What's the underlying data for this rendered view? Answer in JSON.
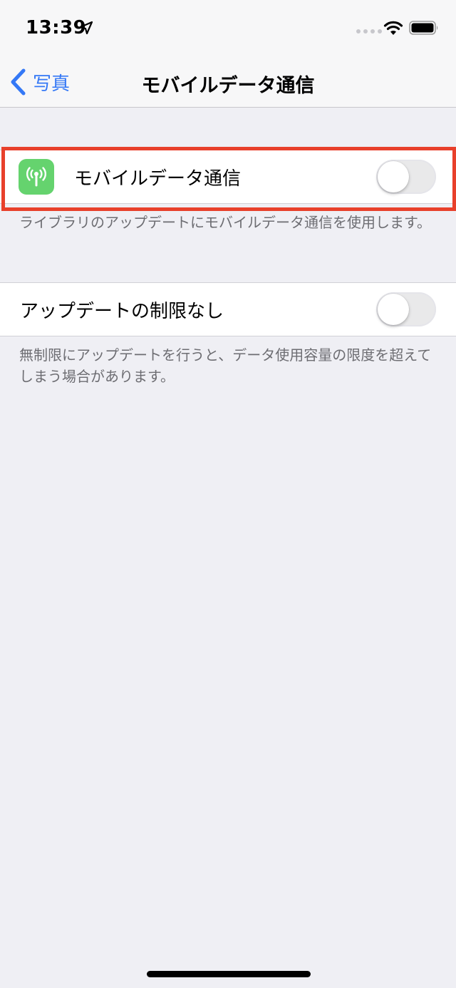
{
  "status_bar": {
    "time": "13:39",
    "location_icon": "location-arrow-icon",
    "wifi_icon": "wifi-icon",
    "battery_icon": "battery-icon"
  },
  "nav": {
    "back_label": "写真",
    "title": "モバイルデータ通信"
  },
  "sections": {
    "mobile_data": {
      "icon": "antenna-icon",
      "label": "モバイルデータ通信",
      "enabled": false,
      "footer": "ライブラリのアップデートにモバイルデータ通信を使用します。"
    },
    "unlimited_updates": {
      "label": "アップデートの制限なし",
      "enabled": false,
      "footer": "無制限にアップデートを行うと、データ使用容量の限度を超えてしまう場合があります。"
    }
  },
  "colors": {
    "accent": "#3478f6",
    "icon_green": "#65d36e",
    "highlight": "#e8402b",
    "background": "#efeff4"
  }
}
